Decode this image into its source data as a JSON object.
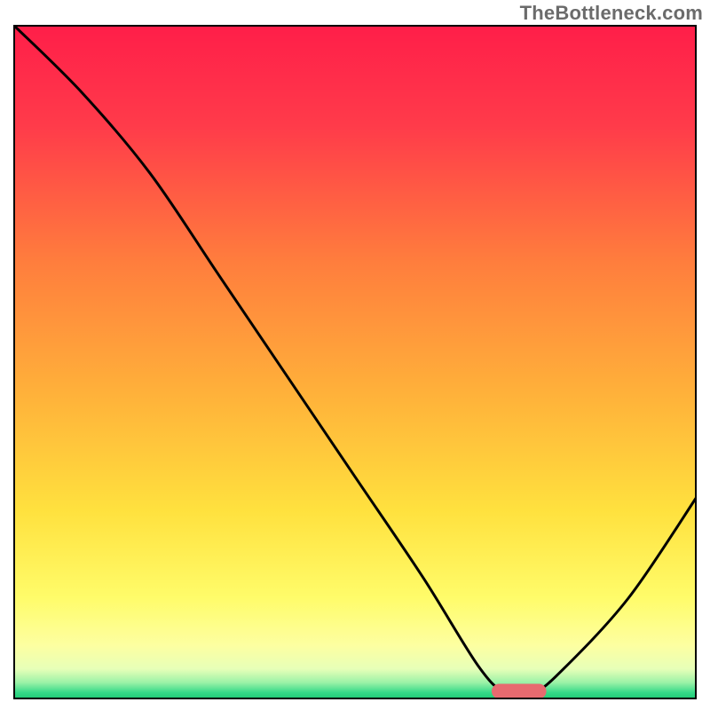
{
  "watermark": "TheBottleneck.com",
  "chart_data": {
    "type": "line",
    "title": "",
    "xlabel": "",
    "ylabel": "",
    "xlim": [
      0,
      100
    ],
    "ylim": [
      0,
      100
    ],
    "grid": false,
    "series": [
      {
        "name": "curve",
        "color": "#000000",
        "x": [
          0,
          10,
          20,
          30,
          40,
          50,
          60,
          68,
          72,
          76,
          80,
          90,
          100
        ],
        "y": [
          100,
          90,
          78,
          63,
          48,
          33,
          18,
          5,
          1,
          1,
          4,
          15,
          30
        ]
      }
    ],
    "background_gradient": {
      "stops": [
        {
          "offset": 0.0,
          "color": "#ff1e49"
        },
        {
          "offset": 0.15,
          "color": "#ff3b4a"
        },
        {
          "offset": 0.35,
          "color": "#ff7d3d"
        },
        {
          "offset": 0.55,
          "color": "#ffb23a"
        },
        {
          "offset": 0.72,
          "color": "#ffe13e"
        },
        {
          "offset": 0.85,
          "color": "#fffc6a"
        },
        {
          "offset": 0.92,
          "color": "#fdffa1"
        },
        {
          "offset": 0.955,
          "color": "#e7ffb8"
        },
        {
          "offset": 0.975,
          "color": "#9cf2a7"
        },
        {
          "offset": 0.99,
          "color": "#35d988"
        },
        {
          "offset": 1.0,
          "color": "#1dc973"
        }
      ]
    },
    "marker": {
      "x_center": 74,
      "y_center": 1.2,
      "width": 8,
      "height": 2.2,
      "color": "#e76a6f",
      "rx": 1.1
    },
    "frame_color": "#000000",
    "frame_width": 2
  }
}
